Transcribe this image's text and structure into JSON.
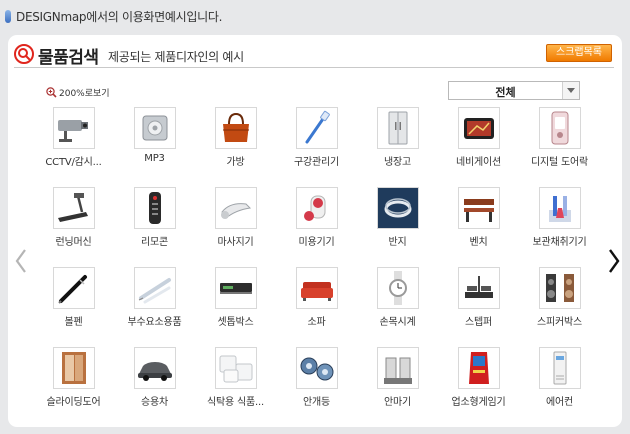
{
  "page": {
    "caption": "DESIGNmap에서의 이용화면예시입니다."
  },
  "header": {
    "title": "물품검색",
    "subtitle": "제공되는 제품디자인의 예시",
    "scrap_label": "스크랩목록"
  },
  "toolbar": {
    "zoom_label": "200%로보기",
    "filter_value": "전체"
  },
  "colors": {
    "accent": "#e0261d",
    "scrap_button": "#f58a0b"
  },
  "products": [
    {
      "label": "CCTV/감시...",
      "icon": "cctv-camera-icon"
    },
    {
      "label": "MP3",
      "icon": "mp3-player-icon"
    },
    {
      "label": "가방",
      "icon": "handbag-icon"
    },
    {
      "label": "구강관리기",
      "icon": "toothbrush-icon"
    },
    {
      "label": "냉장고",
      "icon": "refrigerator-icon"
    },
    {
      "label": "네비게이션",
      "icon": "navigation-device-icon"
    },
    {
      "label": "디지털 도어락",
      "icon": "door-lock-icon"
    },
    {
      "label": "런닝머신",
      "icon": "treadmill-icon"
    },
    {
      "label": "리모콘",
      "icon": "remote-control-icon"
    },
    {
      "label": "마사지기",
      "icon": "massager-icon"
    },
    {
      "label": "미용기기",
      "icon": "beauty-device-icon"
    },
    {
      "label": "반지",
      "icon": "ring-icon"
    },
    {
      "label": "벤치",
      "icon": "bench-icon"
    },
    {
      "label": "보관채취기기",
      "icon": "sample-tube-icon"
    },
    {
      "label": "볼펜",
      "icon": "ballpoint-pen-icon"
    },
    {
      "label": "부수요소용품",
      "icon": "syringe-icon"
    },
    {
      "label": "셋톱박스",
      "icon": "set-top-box-icon"
    },
    {
      "label": "소파",
      "icon": "sofa-icon"
    },
    {
      "label": "손목시계",
      "icon": "wristwatch-icon"
    },
    {
      "label": "스텝퍼",
      "icon": "stepper-icon"
    },
    {
      "label": "스피커박스",
      "icon": "speaker-icon"
    },
    {
      "label": "슬라이딩도어",
      "icon": "sliding-door-icon"
    },
    {
      "label": "승용차",
      "icon": "car-icon"
    },
    {
      "label": "식탁용 식품...",
      "icon": "food-container-icon"
    },
    {
      "label": "안개등",
      "icon": "fog-lamp-icon"
    },
    {
      "label": "안마기",
      "icon": "leg-massager-icon"
    },
    {
      "label": "업소형게임기",
      "icon": "arcade-machine-icon"
    },
    {
      "label": "에어컨",
      "icon": "air-conditioner-icon"
    }
  ]
}
